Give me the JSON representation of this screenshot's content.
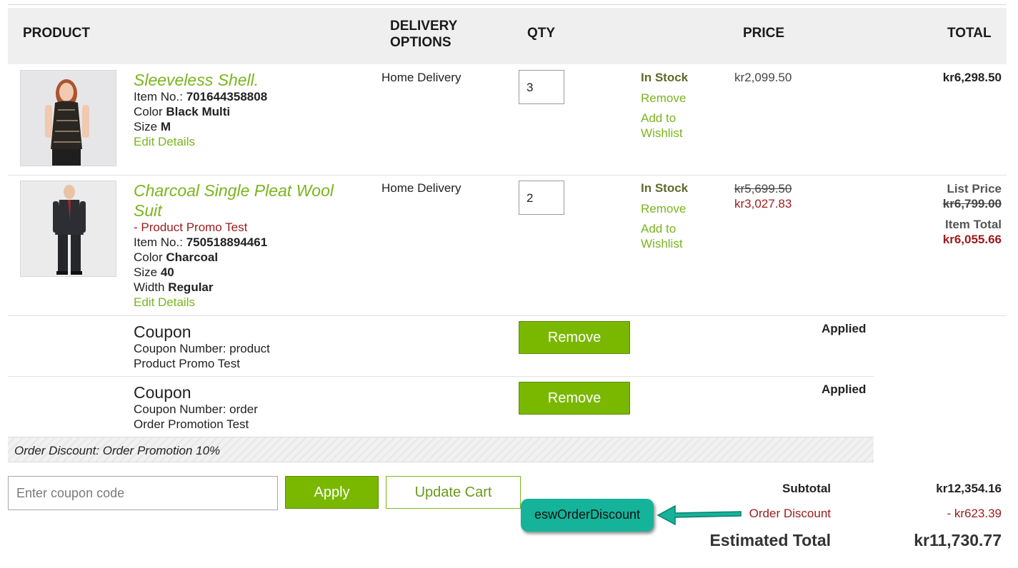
{
  "header": {
    "product": "PRODUCT",
    "delivery_line1": "DELIVERY",
    "delivery_line2": "OPTIONS",
    "qty": "QTY",
    "price": "PRICE",
    "total": "TOTAL"
  },
  "items": [
    {
      "name": "Sleeveless Shell.",
      "item_no_label": "Item No.:",
      "item_no": "701644358808",
      "color_label": "Color",
      "color": "Black Multi",
      "size_label": "Size",
      "size": "M",
      "edit": "Edit Details",
      "delivery": "Home Delivery",
      "qty": "3",
      "stock": "In Stock",
      "remove": "Remove",
      "wishlist_1": "Add to",
      "wishlist_2": "Wishlist",
      "price": "kr2,099.50",
      "total": "kr6,298.50"
    },
    {
      "name_line1": "Charcoal Single Pleat Wool",
      "name_line2": "Suit",
      "promo": "- Product Promo Test",
      "item_no_label": "Item No.:",
      "item_no": "750518894461",
      "color_label": "Color",
      "color": "Charcoal",
      "size_label": "Size",
      "size": "40",
      "width_label": "Width",
      "width": "Regular",
      "edit": "Edit Details",
      "delivery": "Home Delivery",
      "qty": "2",
      "stock": "In Stock",
      "remove": "Remove",
      "wishlist_1": "Add to",
      "wishlist_2": "Wishlist",
      "price_old": "kr5,699.50",
      "price_new": "kr3,027.83",
      "list_price_label": "List Price",
      "list_price": "kr6,799.00",
      "item_total_label": "Item Total",
      "item_total": "kr6,055.66"
    }
  ],
  "coupons": [
    {
      "title": "Coupon",
      "number": "Coupon Number: product",
      "desc": "Product Promo Test",
      "button": "Remove",
      "status": "Applied"
    },
    {
      "title": "Coupon",
      "number": "Coupon Number: order",
      "desc": "Order Promotion Test",
      "button": "Remove",
      "status": "Applied"
    }
  ],
  "order_discount_text": "Order Discount: Order Promotion 10%",
  "coupon_input": {
    "placeholder": "Enter coupon code"
  },
  "buttons": {
    "apply": "Apply",
    "update_cart": "Update Cart"
  },
  "summary": {
    "subtotal_label": "Subtotal",
    "subtotal": "kr12,354.16",
    "discount_label": "Order Discount",
    "discount": "- kr623.39",
    "estimated_label": "Estimated Total",
    "estimated": "kr11,730.77"
  },
  "callout": "eswOrderDiscount",
  "colors": {
    "accent_green": "#7ab800",
    "link_green": "#7ab51d",
    "promo_red": "#9b1b1b",
    "callout_teal": "#15b39a"
  }
}
